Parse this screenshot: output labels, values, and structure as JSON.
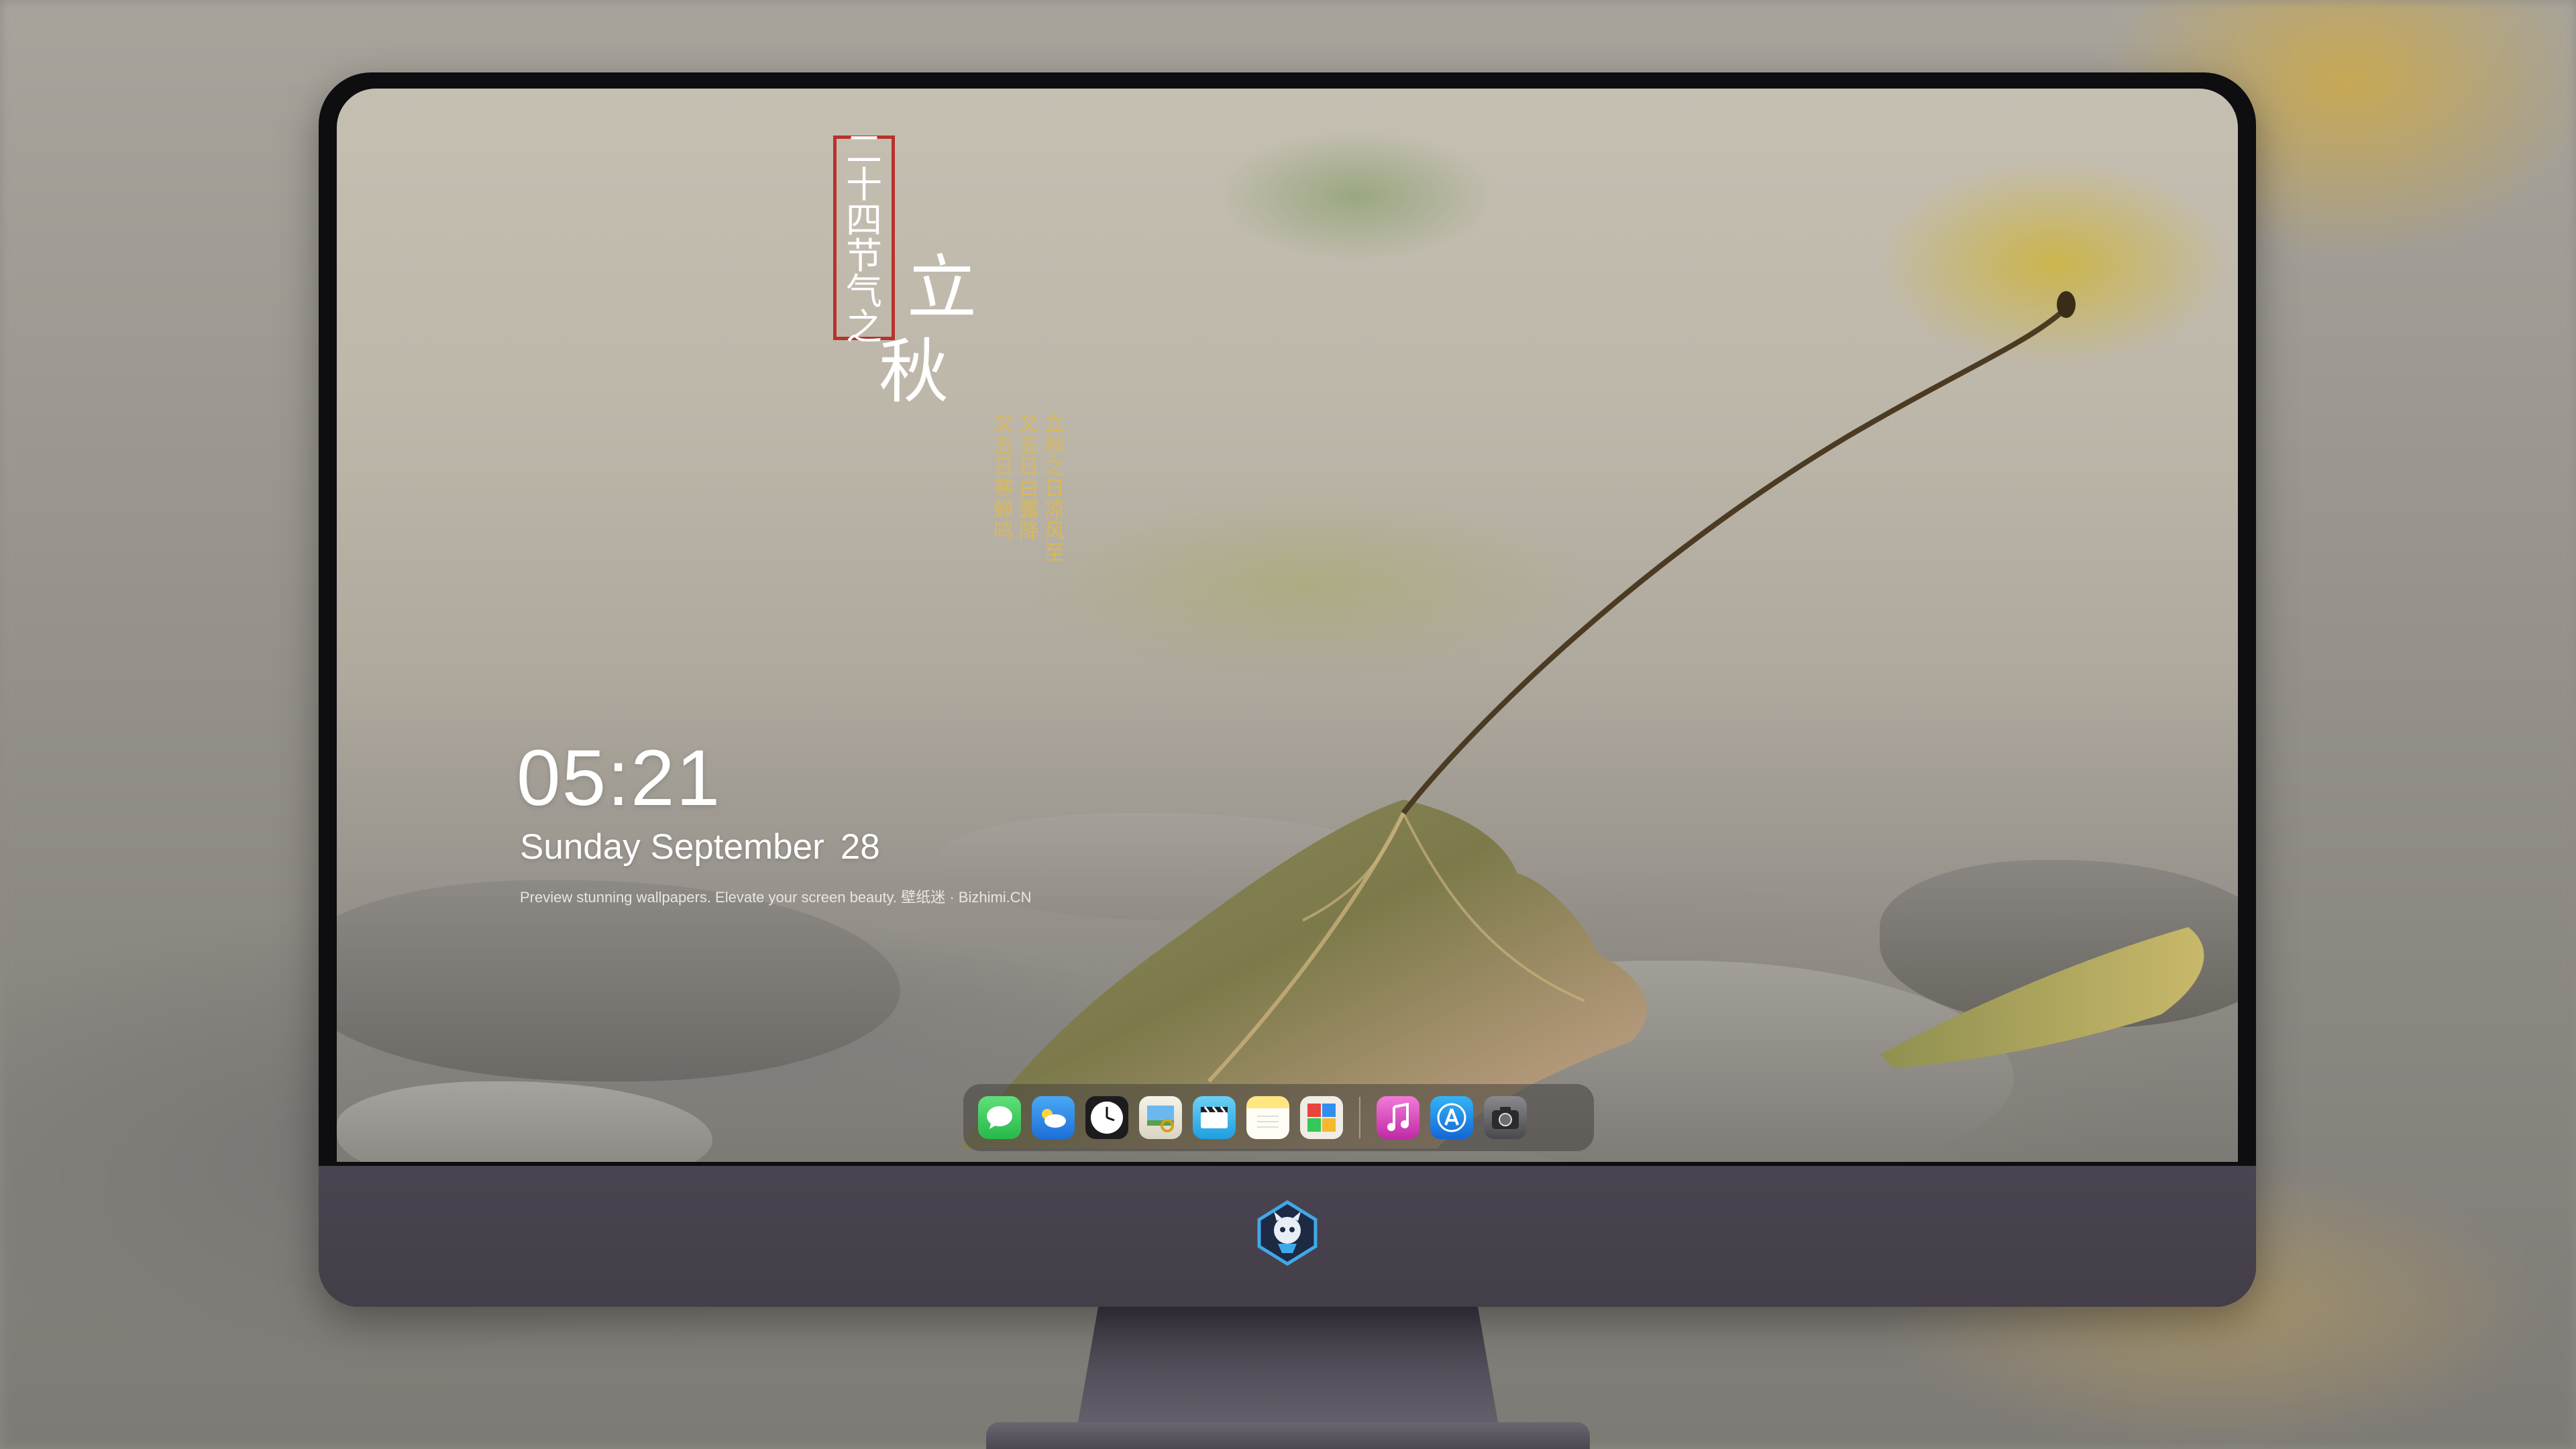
{
  "lockscreen": {
    "time": "05:21",
    "weekday_month": "Sunday September",
    "day": "28",
    "tagline": "Preview stunning wallpapers. Elevate your screen beauty. 壁纸迷 · Bizhimi.CN"
  },
  "solar_term": {
    "box_chars": [
      "二",
      "十",
      "四",
      "节",
      "气",
      "之"
    ],
    "title_chars": [
      "立",
      "秋"
    ],
    "verse_columns": [
      [
        "立",
        "秋",
        "之",
        "日",
        "凉",
        "风",
        "至"
      ],
      [
        "又",
        "五",
        "日",
        "白",
        "露",
        "降"
      ],
      [
        "又",
        "五",
        "日",
        "寒",
        "蝉",
        "鸣"
      ]
    ]
  },
  "dock": {
    "apps": [
      {
        "name": "messages-icon",
        "glyph": "💬",
        "color": "#34c759"
      },
      {
        "name": "weather-icon",
        "glyph": "☁",
        "color": "#2f8ff0"
      },
      {
        "name": "clock-icon",
        "glyph": "🕐",
        "color": "#1c1c1e"
      },
      {
        "name": "preview-icon",
        "glyph": "🖼",
        "color": "#f2c94c"
      },
      {
        "name": "clips-icon",
        "glyph": "🎬",
        "color": "#4fb8e8"
      },
      {
        "name": "notes-icon",
        "glyph": "📝",
        "color": "#ffd54f"
      },
      {
        "name": "photo-booth-icon",
        "glyph": "▦",
        "color": "#e8e6e0"
      },
      {
        "name": "music-icon",
        "glyph": "♫",
        "color": "#e040b8"
      },
      {
        "name": "app-store-icon",
        "glyph": "Ａ",
        "color": "#1e88e5"
      },
      {
        "name": "camera-icon",
        "glyph": "📷",
        "color": "#5b5b5e"
      }
    ]
  },
  "colors": {
    "seal_red": "#b8322c",
    "verse_gold": "#d9b85a",
    "bezel": "#0e0d10",
    "chin": "#4a4450"
  }
}
